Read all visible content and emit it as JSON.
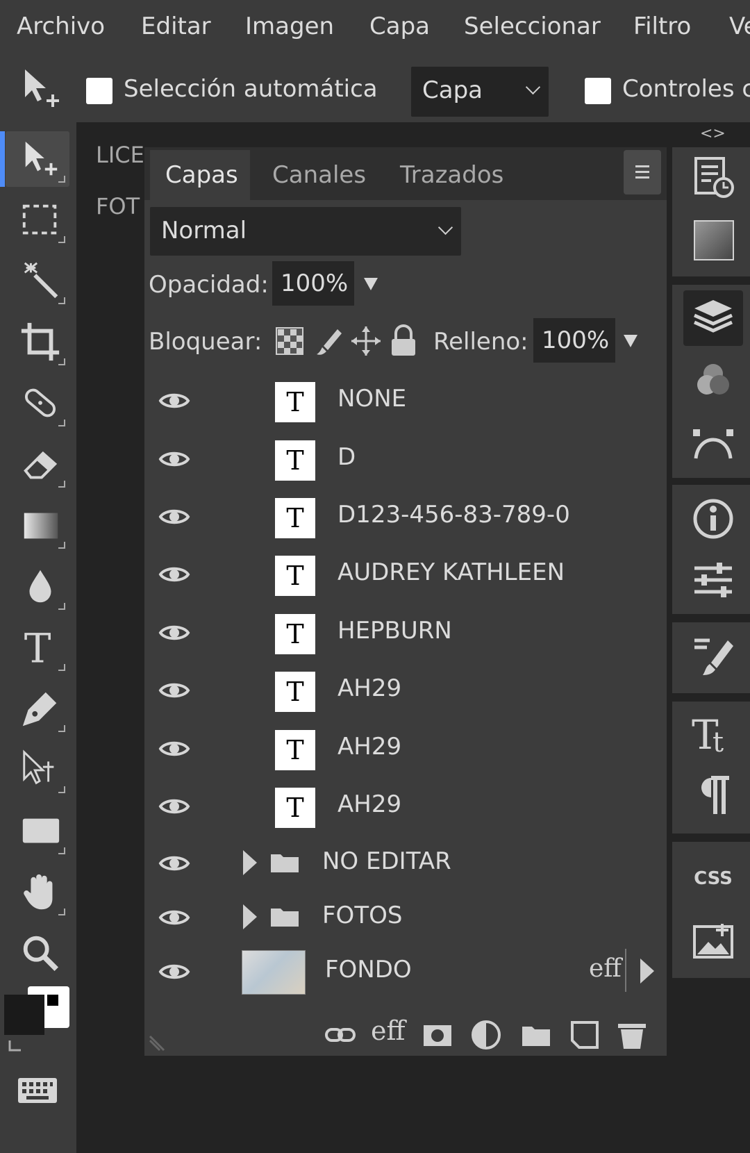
{
  "menubar": {
    "items": [
      "Archivo",
      "Editar",
      "Imagen",
      "Capa",
      "Seleccionar",
      "Filtro",
      "Ve"
    ]
  },
  "options": {
    "auto_select_label": "Selección automática",
    "auto_select_target": "Capa",
    "controls_label": "Controles c"
  },
  "document": {
    "tab_label_1": "LICE",
    "tab_label_2": "FOT"
  },
  "layers_panel": {
    "tabs": [
      "Capas",
      "Canales",
      "Trazados"
    ],
    "blend_mode": "Normal",
    "opacity_label": "Opacidad:",
    "opacity_value": "100%",
    "lock_label": "Bloquear:",
    "fill_label": "Relleno:",
    "fill_value": "100%",
    "layers": [
      {
        "name": "NONE",
        "type": "text"
      },
      {
        "name": "D",
        "type": "text"
      },
      {
        "name": "D123-456-83-789-0",
        "type": "text"
      },
      {
        "name": "AUDREY KATHLEEN",
        "type": "text"
      },
      {
        "name": "HEPBURN",
        "type": "text"
      },
      {
        "name": "AH29",
        "type": "text"
      },
      {
        "name": "AH29",
        "type": "text"
      },
      {
        "name": "AH29",
        "type": "text"
      },
      {
        "name": "NO EDITAR",
        "type": "folder"
      },
      {
        "name": "FOTOS",
        "type": "folder"
      },
      {
        "name": "FONDO",
        "type": "image",
        "effects_label": "eff"
      }
    ],
    "text_thumb_glyph": "T",
    "bottom_effects_label": "eff"
  },
  "right_panel": {
    "css_label": "CSS",
    "collapse_label": "<>"
  },
  "colors": {
    "accent": "#4f8cf7",
    "foreground_color": "#1a1a1a",
    "background_color": "#ffffff"
  }
}
